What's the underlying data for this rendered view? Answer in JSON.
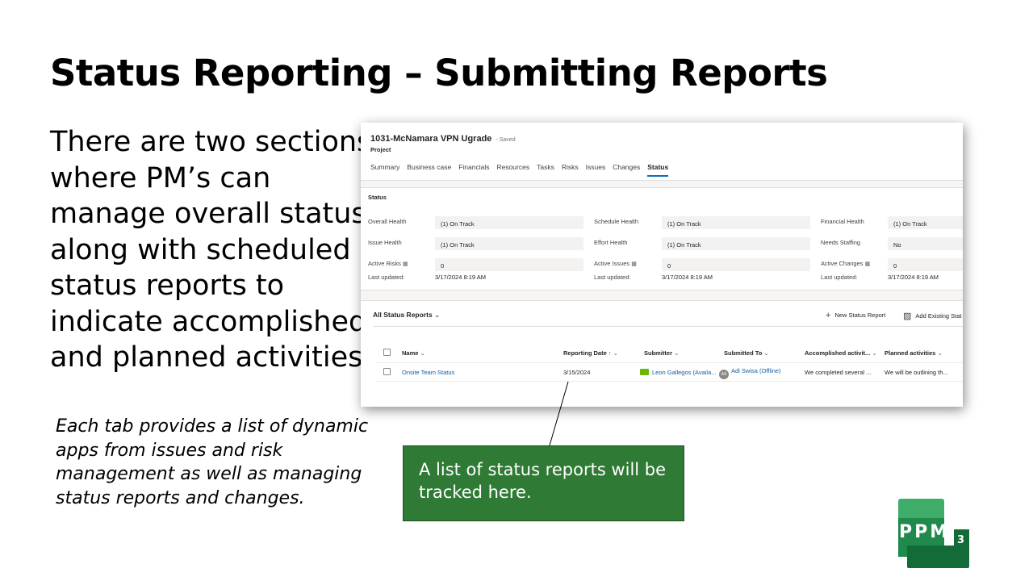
{
  "slide": {
    "title": "Status Reporting – Submitting Reports",
    "body_lines": [
      "There are two sections",
      "where PM’s can",
      "manage overall status",
      "along with scheduled",
      "status reports to",
      "indicate accomplished",
      "and planned activities."
    ],
    "note_lines": [
      "Each tab provides a list of dynamic",
      "apps from issues and risk",
      "management as well as managing",
      "status reports and changes."
    ],
    "callout_lines": [
      "A list of status reports will be",
      "tracked here."
    ]
  },
  "app": {
    "project_title": "1031-McNamara VPN Ugrade",
    "saved_label": "- Saved",
    "entity_label": "Project",
    "tabs": [
      "Summary",
      "Business case",
      "Financials",
      "Resources",
      "Tasks",
      "Risks",
      "Issues",
      "Changes",
      "Status"
    ],
    "active_tab": "Status",
    "status": {
      "heading": "Status",
      "fields": [
        {
          "label": "Overall Health",
          "value": "(1) On Track"
        },
        {
          "label": "Schedule Health",
          "value": "(1) On Track"
        },
        {
          "label": "Financial Health",
          "value": "(1) On Track"
        },
        {
          "label": "Issue Health",
          "value": "(1) On Track"
        },
        {
          "label": "Effort Health",
          "value": "(1) On Track"
        },
        {
          "label": "Needs Staffing",
          "value": "No"
        },
        {
          "label": "Active Risks",
          "value": "0"
        },
        {
          "label": "Active Issues",
          "value": "0"
        },
        {
          "label": "Active Changes",
          "value": "0"
        }
      ],
      "last_updated_label": "Last updated:",
      "last_updated": [
        "3/17/2024 8:19 AM",
        "3/17/2024 8:19 AM",
        "3/17/2024 8:19 AM"
      ]
    },
    "reports": {
      "view_title": "All Status Reports",
      "new_button": "New Status Report",
      "add_existing_button": "Add Existing Stat",
      "columns": [
        "Name",
        "Reporting Date",
        "Submitter",
        "Submitted To",
        "Accomplished activit...",
        "Planned activities"
      ],
      "rows": [
        {
          "name": "Onsite Team Status",
          "reporting_date": "3/15/2024",
          "submitter": "Leon Gallegos (Availa...",
          "submitted_to": "Adi Swisa (Offline)",
          "avatar_initials": "AS",
          "accomplished": "We completed several ...",
          "planned": "We will be outlining th..."
        }
      ]
    }
  },
  "logo": {
    "text": "PPM",
    "superscript": "3",
    "colors": [
      "#3fae6a",
      "#1f8a4c",
      "#136b38"
    ]
  },
  "colors": {
    "callout_bg": "#2f7a34",
    "link": "#115ea3",
    "tab_underline": "#0f6cbd"
  }
}
